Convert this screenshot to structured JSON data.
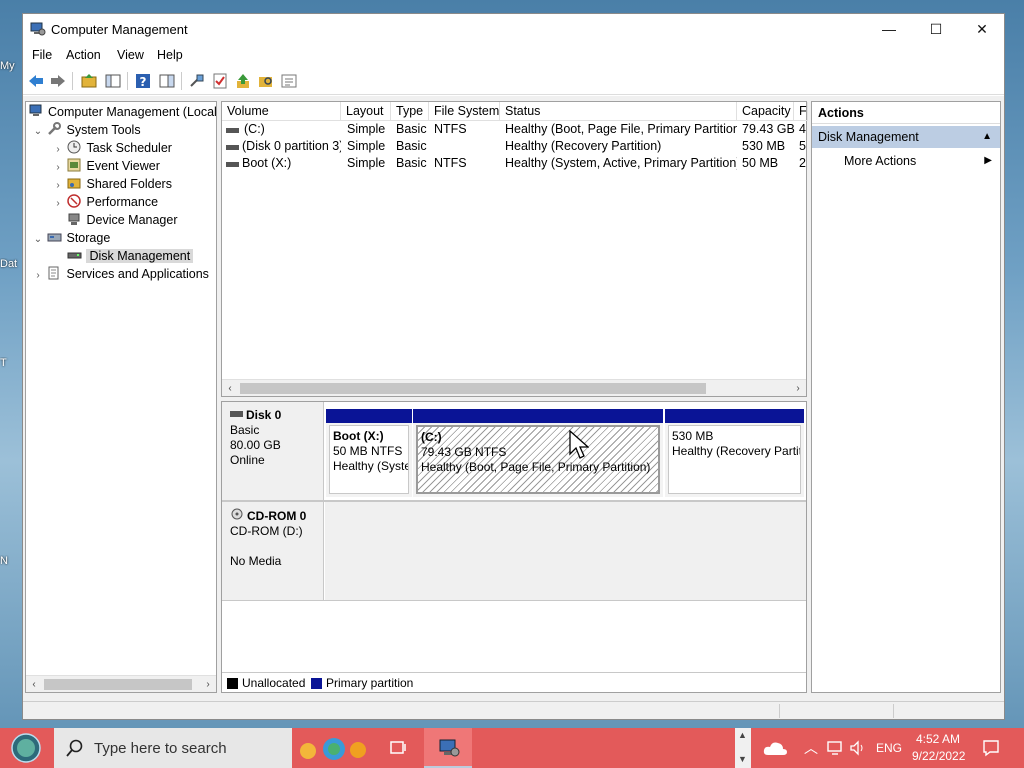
{
  "desktop": {
    "icon_labels": [
      "My",
      "Dat",
      "T",
      "N"
    ]
  },
  "window": {
    "title": "Computer Management",
    "controls": {
      "minimize": "—",
      "maximize": "☐",
      "close": "✕"
    }
  },
  "menu": [
    "File",
    "Action",
    "View",
    "Help"
  ],
  "tree": {
    "root": "Computer Management (Local",
    "system_tools": "System Tools",
    "task_scheduler": "Task Scheduler",
    "event_viewer": "Event Viewer",
    "shared_folders": "Shared Folders",
    "performance": "Performance",
    "device_manager": "Device Manager",
    "storage": "Storage",
    "disk_management": "Disk Management",
    "services": "Services and Applications"
  },
  "volumes": {
    "headers": [
      "Volume",
      "Layout",
      "Type",
      "File System",
      "Status",
      "Capacity",
      "F"
    ],
    "rows": [
      [
        "(C:)",
        "Simple",
        "Basic",
        "NTFS",
        "Healthy (Boot, Page File, Primary Partition)",
        "79.43 GB",
        "4"
      ],
      [
        "(Disk 0 partition 3)",
        "Simple",
        "Basic",
        "",
        "Healthy (Recovery Partition)",
        "530 MB",
        "5"
      ],
      [
        "Boot (X:)",
        "Simple",
        "Basic",
        "NTFS",
        "Healthy (System, Active, Primary Partition)",
        "50 MB",
        "2"
      ]
    ]
  },
  "disks": {
    "disk0": {
      "name": "Disk 0",
      "type": "Basic",
      "size": "80.00 GB",
      "state": "Online"
    },
    "partitions": [
      {
        "name": "Boot  (X:)",
        "size": "50 MB NTFS",
        "status": "Healthy (Syste"
      },
      {
        "name": "(C:)",
        "size": "79.43 GB NTFS",
        "status": "Healthy (Boot, Page File, Primary Partition)"
      },
      {
        "name": "",
        "size": "530 MB",
        "status": "Healthy (Recovery Partit"
      }
    ],
    "cdrom": {
      "name": "CD-ROM 0",
      "drive": "CD-ROM (D:)",
      "media": "No Media"
    },
    "legend": {
      "unallocated": "Unallocated",
      "primary": "Primary partition"
    }
  },
  "actions": {
    "header": "Actions",
    "section": "Disk Management",
    "more": "More Actions"
  },
  "taskbar": {
    "search_placeholder": "Type here to search",
    "lang": "ENG",
    "time": "4:52 AM",
    "date": "9/22/2022"
  },
  "colors": {
    "primary_partition": "#0a1496",
    "taskbar": "#e35a5a",
    "actions_section": "#bccde3"
  }
}
